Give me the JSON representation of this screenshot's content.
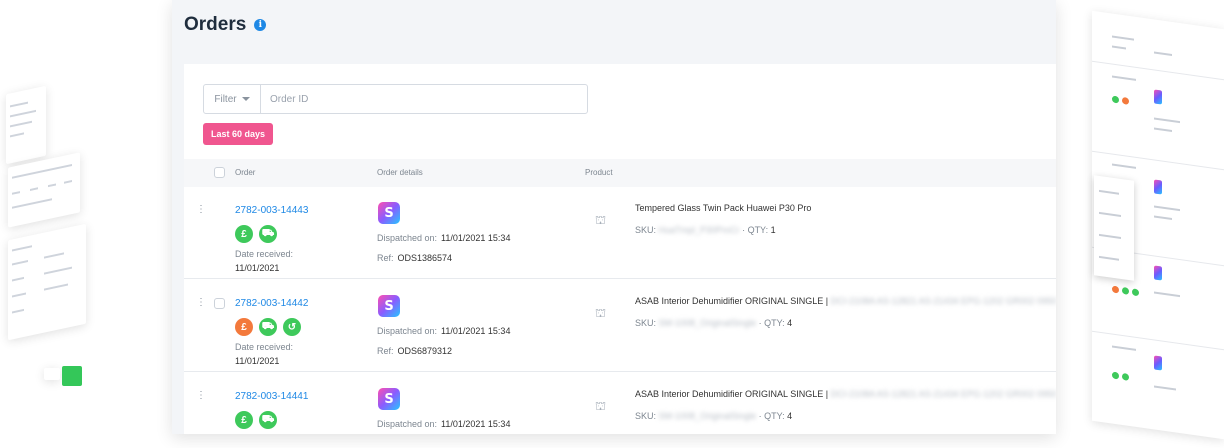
{
  "header": {
    "title": "Orders",
    "info_icon": "info-icon"
  },
  "filter": {
    "select_label": "Filter",
    "input_placeholder": "Order ID"
  },
  "chip": {
    "label": "Last 60 days",
    "color": "#f0568f"
  },
  "table": {
    "columns": [
      "Order",
      "Order details",
      "Product"
    ],
    "rows": [
      {
        "order_id": "2782-003-14443",
        "status_icons": [
          "pound-icon",
          "truck-icon"
        ],
        "date_label": "Date received:",
        "date_value": "11/01/2021",
        "dispatched_label": "Dispatched on:",
        "dispatched_value": "11/01/2021 15:34",
        "ref_label": "Ref:",
        "ref_value": "ODS1386574",
        "product_name": "Tempered Glass Twin Pack Huawei P30 Pro",
        "product_name_hidden": "",
        "sku_label": "SKU:",
        "sku_value": "HuaTmpl_P30ProCr",
        "qty_label": "QTY:",
        "qty_value": "1"
      },
      {
        "order_id": "2782-003-14442",
        "status_icons": [
          "pound-icon",
          "truck-icon",
          "return-icon"
        ],
        "date_label": "Date received:",
        "date_value": "11/01/2021",
        "dispatched_label": "Dispatched on:",
        "dispatched_value": "11/01/2021 15:34",
        "ref_label": "Ref:",
        "ref_value": "ODS6879312",
        "product_name": "ASAB Interior Dehumidifier ORIGINAL SINGLE |",
        "product_name_hidden": "DCI-2108A AS-12821 AS-21434 EPG-1202 GR002 0950",
        "sku_label": "SKU:",
        "sku_value": "SM-1008_OriginalSingle",
        "qty_label": "QTY:",
        "qty_value": "4"
      },
      {
        "order_id": "2782-003-14441",
        "status_icons": [
          "pound-icon",
          "truck-icon"
        ],
        "date_label": "",
        "date_value": "",
        "dispatched_label": "Dispatched on:",
        "dispatched_value": "11/01/2021 15:34",
        "ref_label": "",
        "ref_value": "",
        "product_name": "ASAB Interior Dehumidifier ORIGINAL SINGLE |",
        "product_name_hidden": "DCI-2108A AS-12821 AS-21434 EPG-1202 GR002 0950",
        "sku_label": "SKU:",
        "sku_value": "SM-1008_OriginalSingle",
        "qty_label": "QTY:",
        "qty_value": "4"
      }
    ]
  },
  "colors": {
    "link": "#1e88e5",
    "status_green": "#3ec95b",
    "status_orange": "#f3793c"
  }
}
